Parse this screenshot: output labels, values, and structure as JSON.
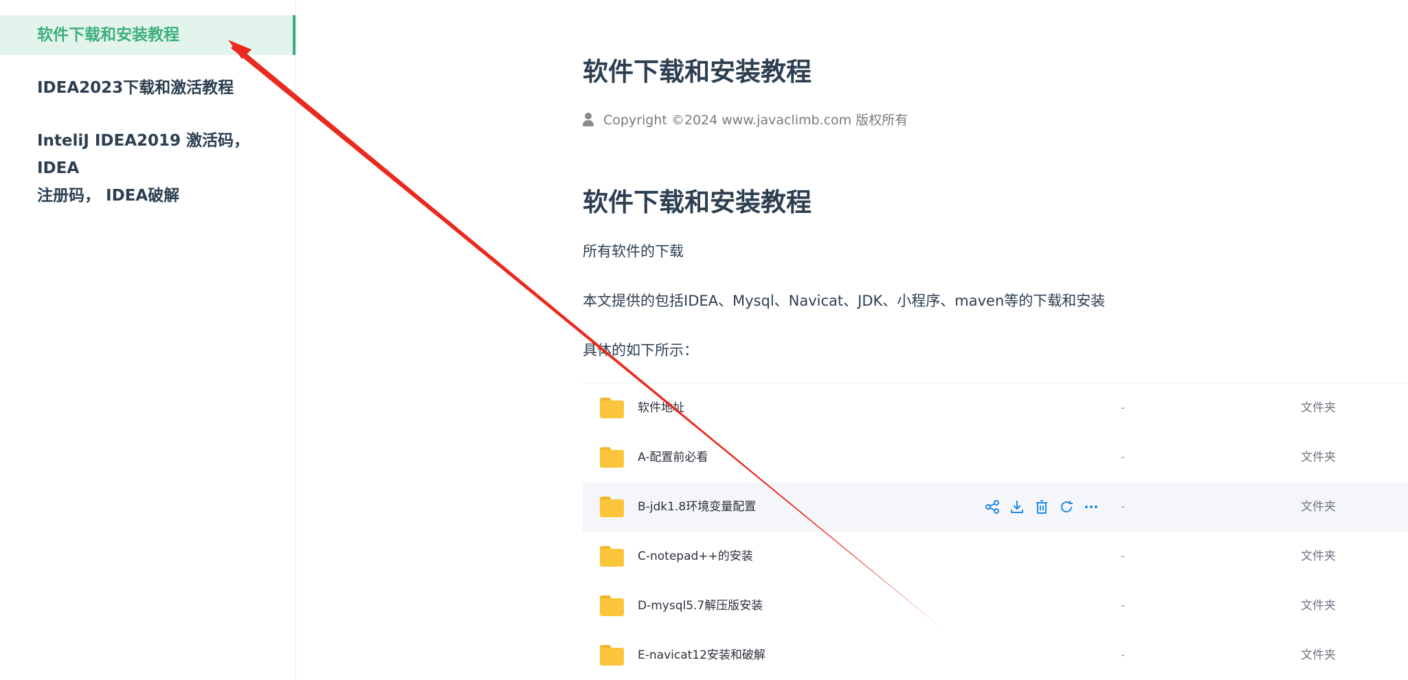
{
  "sidebar": {
    "items": [
      {
        "label": "软件下载和安装教程",
        "active": true
      },
      {
        "label": "IDEA2023下载和激活教程",
        "active": false
      },
      {
        "label_line1": "InteliJ IDEA2019 激活码，IDEA",
        "label_line2": "注册码， IDEA破解",
        "active": false
      }
    ]
  },
  "article": {
    "title": "软件下载和安装教程",
    "copyright": "Copyright ©2024 www.javaclimb.com 版权所有",
    "heading": "软件下载和安装教程",
    "paragraphs": [
      "所有软件的下载",
      "本文提供的包括IDEA、Mysql、Navicat、JDK、小程序、maven等的下载和安装",
      "具体的如下所示："
    ]
  },
  "file_list": {
    "rows": [
      {
        "name": "软件地址",
        "size": "-",
        "type": "文件夹"
      },
      {
        "name": "A-配置前必看",
        "size": "-",
        "type": "文件夹"
      },
      {
        "name": "B-jdk1.8环境变量配置",
        "size": "-",
        "type": "文件夹"
      },
      {
        "name": "C-notepad++的安装",
        "size": "-",
        "type": "文件夹"
      },
      {
        "name": "D-mysql5.7解压版安装",
        "size": "-",
        "type": "文件夹"
      },
      {
        "name": "E-navicat12安装和破解",
        "size": "-",
        "type": "文件夹"
      }
    ],
    "hovered_row": 2,
    "row_actions": [
      "share-icon",
      "download-icon",
      "delete-icon",
      "refresh-icon",
      "more-icon"
    ]
  },
  "colors": {
    "accent": "#3eaf7c",
    "active_bg": "#e3f4ec",
    "folder": "#fbc53b",
    "action_icon": "#1e88e5",
    "annotation": "#ea2a1e"
  }
}
